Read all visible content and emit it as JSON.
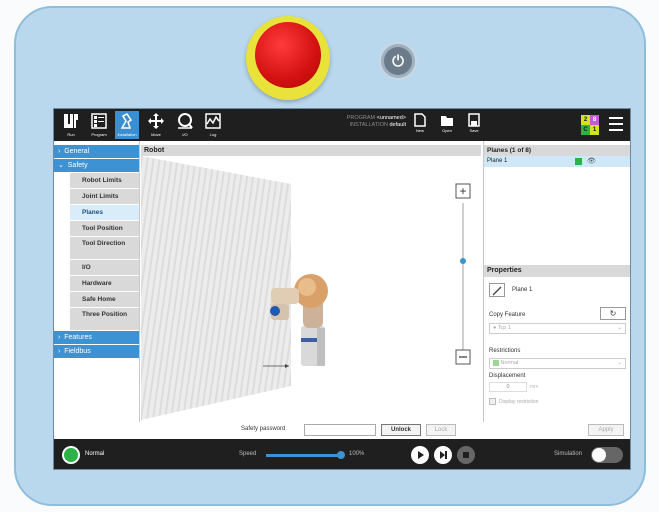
{
  "nav": [
    {
      "label": "Run",
      "icon": "ur-logo-icon"
    },
    {
      "label": "Program",
      "icon": "program-icon"
    },
    {
      "label": "Installation",
      "icon": "installation-icon"
    },
    {
      "label": "Move",
      "icon": "move-icon"
    },
    {
      "label": "I/O",
      "icon": "io-icon"
    },
    {
      "label": "Log",
      "icon": "log-icon"
    }
  ],
  "program": {
    "program_label": "PROGRAM",
    "program_name": "<unnamed>",
    "installation_label": "INSTALLATION",
    "installation_name": "default"
  },
  "file_buttons": {
    "new": "New",
    "open": "Open",
    "save": "Save"
  },
  "badge": {
    "top_left": "2",
    "top_right": "8",
    "bottom_left": "C",
    "bottom_right": "1"
  },
  "sidebar": {
    "general": "General",
    "safety": "Safety",
    "safety_items": [
      "Robot Limits",
      "Joint Limits",
      "Planes",
      "Tool Position",
      "Tool Direction",
      "I/O",
      "Hardware",
      "Safe Home",
      "Three Position"
    ],
    "features": "Features",
    "fieldbus": "Fieldbus"
  },
  "content_title": "Robot",
  "planes": {
    "title": "Planes (1 of 8)",
    "items": [
      "Plane 1"
    ]
  },
  "properties": {
    "title": "Properties",
    "plane_name": "Plane 1",
    "copy_feature_label": "Copy Feature",
    "copy_feature_value": "Tcp 1",
    "restrictions_label": "Restrictions",
    "restrictions_value": "Normal",
    "displacement_label": "Displacement",
    "displacement_value": "0",
    "displacement_unit": "mm",
    "display_restriction": "Display restriction"
  },
  "password": {
    "label": "Safety password",
    "value": "",
    "unlock": "Unlock",
    "lock": "Lock",
    "apply": "Apply"
  },
  "status": {
    "state": "Normal",
    "speed_label": "Speed",
    "speed_value": "100%",
    "speed_fraction": 1.0,
    "simulation_label": "Simulation"
  },
  "colors": {
    "accent": "#3c92d3",
    "status_green": "#2bb34a",
    "estop_red": "#d31010"
  }
}
